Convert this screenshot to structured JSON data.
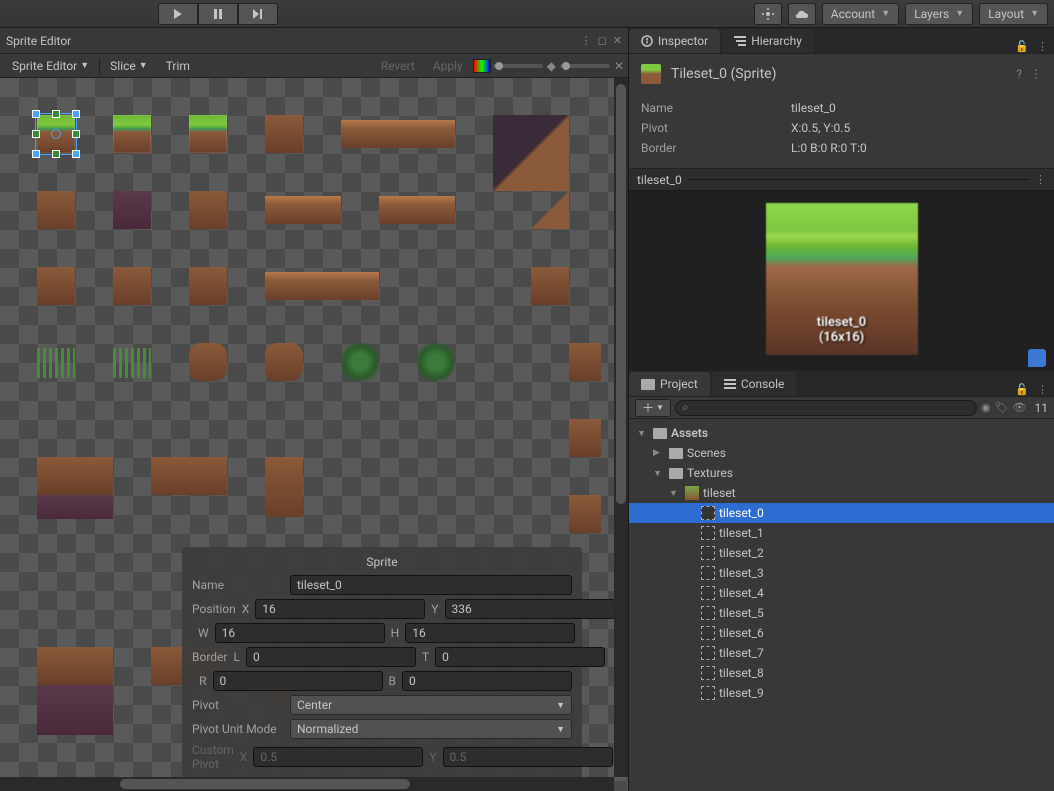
{
  "toolbar": {
    "account": "Account",
    "layers": "Layers",
    "layout": "Layout"
  },
  "editor": {
    "title": "Sprite Editor",
    "dropdown": "Sprite Editor",
    "slice": "Slice",
    "trim": "Trim",
    "revert": "Revert",
    "apply": "Apply"
  },
  "sprite_panel": {
    "title": "Sprite",
    "name_label": "Name",
    "name_value": "tileset_0",
    "position_label": "Position",
    "border_label": "Border",
    "pivot_label": "Pivot",
    "pivot_value": "Center",
    "pivot_unit_label": "Pivot Unit Mode",
    "pivot_unit_value": "Normalized",
    "custom_pivot_label": "Custom Pivot",
    "x_label": "X",
    "y_label": "Y",
    "w_label": "W",
    "h_label": "H",
    "l_label": "L",
    "t_label": "T",
    "r_label": "R",
    "b_label": "B",
    "pos_x": "16",
    "pos_y": "336",
    "pos_w": "16",
    "pos_h": "16",
    "border_l": "0",
    "border_t": "0",
    "border_r": "0",
    "border_b": "0",
    "cpivot_x": "0.5",
    "cpivot_y": "0.5"
  },
  "tabs": {
    "inspector": "Inspector",
    "hierarchy": "Hierarchy",
    "project": "Project",
    "console": "Console"
  },
  "inspector": {
    "title": "Tileset_0 (Sprite)",
    "name_label": "Name",
    "name_value": "tileset_0",
    "pivot_label": "Pivot",
    "pivot_value": "X:0.5, Y:0.5",
    "border_label": "Border",
    "border_value": "L:0 B:0 R:0 T:0"
  },
  "preview": {
    "title": "tileset_0",
    "sprite_label": "tileset_0",
    "sprite_dim": "(16x16)"
  },
  "project": {
    "slider_count": "11",
    "root": "Assets",
    "folders": {
      "scenes": "Scenes",
      "textures": "Textures",
      "tileset": "tileset"
    },
    "sprites": [
      "tileset_0",
      "tileset_1",
      "tileset_2",
      "tileset_3",
      "tileset_4",
      "tileset_5",
      "tileset_6",
      "tileset_7",
      "tileset_8",
      "tileset_9"
    ]
  }
}
